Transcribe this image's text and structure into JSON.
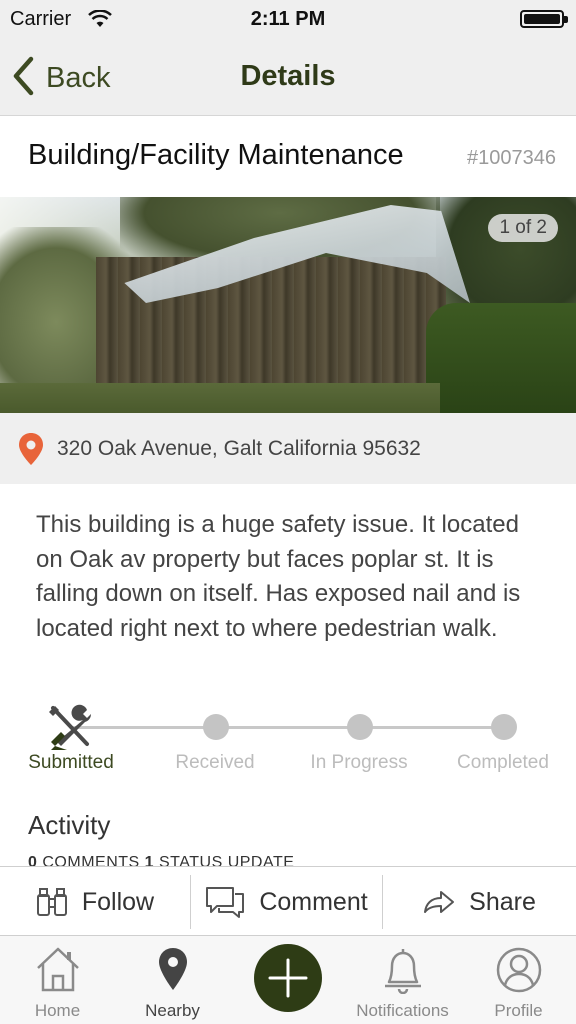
{
  "status_bar": {
    "carrier": "Carrier",
    "time": "2:11 PM"
  },
  "nav": {
    "back_label": "Back",
    "title": "Details"
  },
  "issue": {
    "category": "Building/Facility Maintenance",
    "id": "#1007346",
    "photo_counter": "1 of 2",
    "address": "320  Oak Avenue, Galt California 95632",
    "description": "This building is a huge safety issue. It located on Oak av property but faces poplar st. It is falling down on itself. Has exposed nail and is located right next to where pedestrian walk."
  },
  "progress": {
    "steps": [
      {
        "label": "Submitted",
        "active": true
      },
      {
        "label": "Received",
        "active": false
      },
      {
        "label": "In Progress",
        "active": false
      },
      {
        "label": "Completed",
        "active": false
      }
    ]
  },
  "activity": {
    "heading": "Activity",
    "comments_count": "0",
    "comments_label": "COMMENTS",
    "status_count": "1",
    "status_label": "STATUS UPDATE"
  },
  "actions": {
    "follow": "Follow",
    "comment": "Comment",
    "share": "Share"
  },
  "tabs": {
    "home": "Home",
    "nearby": "Nearby",
    "notifications": "Notifications",
    "profile": "Profile"
  },
  "colors": {
    "accent": "#3d4a22",
    "fab": "#2e3c15",
    "pin": "#e8643a"
  },
  "icons": {
    "back": "chevron-left-icon",
    "pin": "location-pin-icon",
    "follow": "binoculars-icon",
    "comment": "speech-bubbles-icon",
    "share": "share-arrow-icon",
    "home": "house-icon",
    "nearby": "map-pin-icon",
    "add": "plus-icon",
    "notifications": "bell-icon",
    "profile": "person-icon",
    "submitted": "tools-icon"
  }
}
